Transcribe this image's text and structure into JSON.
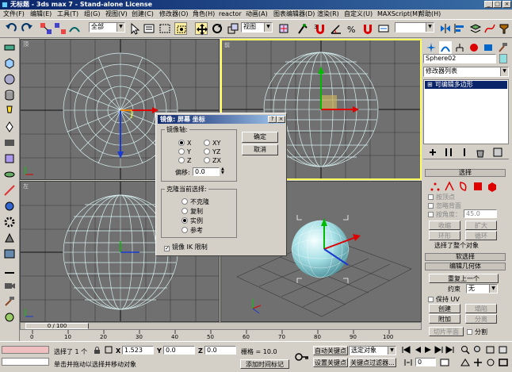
{
  "window": {
    "title": "无标题 - 3ds max 7 - Stand-alone License",
    "min_label": "_",
    "max_label": "□",
    "close_label": "×"
  },
  "menu": [
    "文件(F)",
    "编辑(E)",
    "工具(T)",
    "组(G)",
    "视图(V)",
    "创建(C)",
    "修改器(O)",
    "角色(H)",
    "reactor",
    "动画(A)",
    "图表编辑器(D)",
    "渲染(R)",
    "自定义(U)",
    "MAXScript(M)",
    "帮助(H)"
  ],
  "toolbar": {
    "selection_filter": "全部",
    "reference_coord": "视图",
    "named_selection": ""
  },
  "viewports": [
    {
      "label": "顶"
    },
    {
      "label": "前"
    },
    {
      "label": "左"
    },
    {
      "label": ""
    }
  ],
  "command_panel": {
    "object_name": "Sphere02",
    "modifier_list": "修改器列表",
    "stack_item": "可编辑多边形",
    "selection_rollout": "选择",
    "by_vertex": "按顶点",
    "ignore_backfacing": "忽略背面",
    "by_angle": "按角度：",
    "angle_value": "45.0",
    "shrink": "收缩",
    "grow": "扩大",
    "ring": "环形",
    "loop": "循环",
    "selection_info": "选择了整个对象",
    "soft_selection": "软选择",
    "edit_geometry": "编辑几何体",
    "repeat_last": "重复上一个",
    "constraints": "约束",
    "constraints_value": "无",
    "preserve_uv": "保持 UV",
    "create": "创建",
    "collapse": "塌陷",
    "attach": "附加",
    "detach": "分离",
    "slice_plane": "切片平面",
    "split": "分割"
  },
  "dialog": {
    "title": "镜像: 屏幕 坐标",
    "help": "?",
    "close": "×",
    "mirror_axis_group": "镜像轴:",
    "axes": [
      "X",
      "Y",
      "Z",
      "XY",
      "YZ",
      "ZX"
    ],
    "selected_axis": "X",
    "offset_label": "偏移:",
    "offset_value": "0.0",
    "clone_group": "克隆当前选择:",
    "clone_options": [
      "不克隆",
      "复制",
      "实例",
      "参考"
    ],
    "selected_clone": "实例",
    "mirror_ik": "镜像 IK 限制",
    "ok": "确定",
    "cancel": "取消"
  },
  "timeline": {
    "frame_label": "0 / 100",
    "ticks": [
      "0",
      "10",
      "20",
      "30",
      "40",
      "50",
      "60",
      "70",
      "80",
      "90",
      "100"
    ]
  },
  "status": {
    "selection": "选择了 1 个",
    "x_label": "X",
    "x_value": "1.523",
    "y_label": "Y",
    "y_value": "0.0",
    "z_label": "Z",
    "z_value": "0.0",
    "grid": "栅格 = 10.0",
    "prompt": "单击并拖动以选择并移动对象",
    "add_time_tag": "添加时间标记",
    "auto_key": "自动关键点",
    "selected_object": "选定对象",
    "set_key": "设置关键点",
    "key_filters": "关键点过滤器...",
    "frame": "0"
  }
}
